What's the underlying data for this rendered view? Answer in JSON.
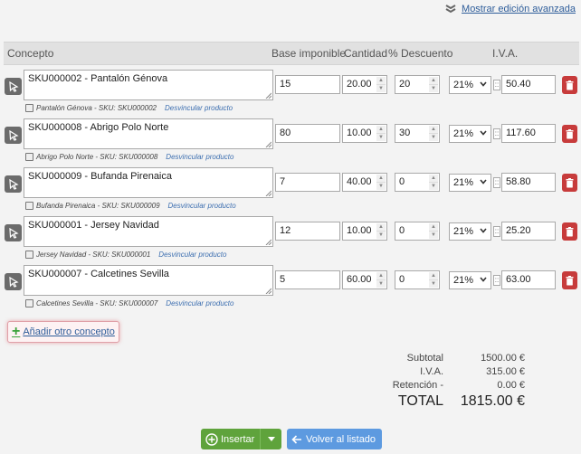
{
  "top_link": {
    "label": "Mostrar edición avanzada"
  },
  "header": {
    "concepto": "Concepto",
    "base": "Base imponible",
    "cantidad": "Cantidad",
    "descuento": "% Descuento",
    "iva": "I.V.A."
  },
  "rows": [
    {
      "concept": "SKU000002 - Pantalón Génova",
      "base": "15",
      "qty": "20.00",
      "discount": "20",
      "vat": "21%",
      "line_total": "50.40",
      "meta": "Pantalón Génova - SKU: SKU000002",
      "unlink": "Desvincular producto"
    },
    {
      "concept": "SKU000008 - Abrigo Polo Norte",
      "base": "80",
      "qty": "10.00",
      "discount": "30",
      "vat": "21%",
      "line_total": "117.60",
      "meta": "Abrigo Polo Norte - SKU: SKU000008",
      "unlink": "Desvincular producto"
    },
    {
      "concept": "SKU000009 - Bufanda Pirenaica",
      "base": "7",
      "qty": "40.00",
      "discount": "0",
      "vat": "21%",
      "line_total": "58.80",
      "meta": "Bufanda Pirenaica - SKU: SKU000009",
      "unlink": "Desvincular producto"
    },
    {
      "concept": "SKU000001 - Jersey Navidad",
      "base": "12",
      "qty": "10.00",
      "discount": "0",
      "vat": "21%",
      "line_total": "25.20",
      "meta": "Jersey Navidad - SKU: SKU000001",
      "unlink": "Desvincular producto"
    },
    {
      "concept": "SKU000007 - Calcetines Sevilla",
      "base": "5",
      "qty": "60.00",
      "discount": "0",
      "vat": "21%",
      "line_total": "63.00",
      "meta": "Calcetines Sevilla - SKU: SKU000007",
      "unlink": "Desvincular producto"
    }
  ],
  "add_concept": {
    "label": "Añadir otro concepto"
  },
  "totals": {
    "subtotal_label": "Subtotal",
    "subtotal": "1500.00 €",
    "iva_label": "I.V.A.",
    "iva": "315.00 €",
    "retencion_label": "Retención -",
    "retencion": "0.00 €",
    "total_label": "TOTAL",
    "total": "1815.00 €"
  },
  "buttons": {
    "insert": "Insertar",
    "back": "Volver al listado"
  },
  "colors": {
    "insert": "#5fa33c",
    "back": "#5d9ae0",
    "delete": "#c73b3b",
    "link": "#2e5d9a"
  }
}
